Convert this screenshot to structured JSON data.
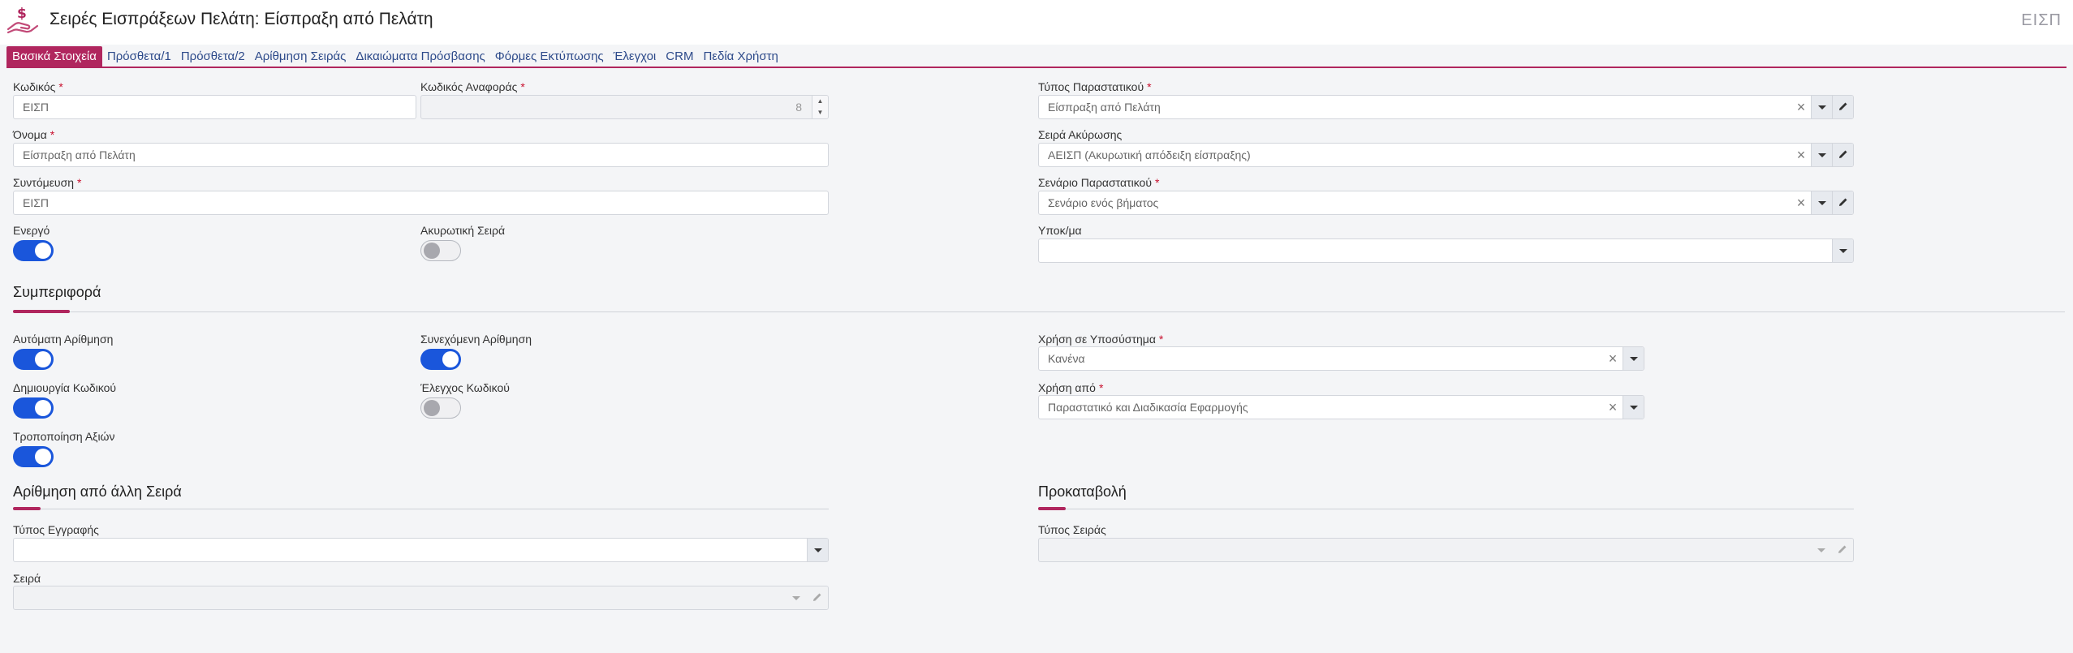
{
  "header": {
    "title": "Σειρές Εισπράξεων Πελάτη: Είσπραξη από Πελάτη",
    "code": "ΕΙΣΠ",
    "icon": "hand-money-icon"
  },
  "tabs": [
    {
      "label": "Βασικά Στοιχεία",
      "active": true
    },
    {
      "label": "Πρόσθετα/1"
    },
    {
      "label": "Πρόσθετα/2"
    },
    {
      "label": "Αρίθμηση Σειράς"
    },
    {
      "label": "Δικαιώματα Πρόσβασης"
    },
    {
      "label": "Φόρμες Εκτύπωσης"
    },
    {
      "label": "Έλεγχοι"
    },
    {
      "label": "CRM"
    },
    {
      "label": "Πεδία Χρήστη"
    }
  ],
  "basic": {
    "code": {
      "label": "Κωδικός",
      "value": "ΕΙΣΠ"
    },
    "ref_code": {
      "label": "Κωδικός Αναφοράς",
      "value": "8"
    },
    "name": {
      "label": "Όνομα",
      "value": "Είσπραξη από Πελάτη"
    },
    "short": {
      "label": "Συντόμευση",
      "value": "ΕΙΣΠ"
    },
    "active": {
      "label": "Ενεργό",
      "on": true
    },
    "cancel_series": {
      "label": "Ακυρωτική Σειρά",
      "on": false
    },
    "doc_type": {
      "label": "Τύπος Παραστατικού",
      "value": "Είσπραξη από Πελάτη"
    },
    "cancel_ser": {
      "label": "Σειρά Ακύρωσης",
      "value": "ΑΕΙΣΠ (Ακυρωτική απόδειξη είσπραξης)"
    },
    "scenario": {
      "label": "Σενάριο Παραστατικού",
      "value": "Σενάριο ενός βήματος"
    },
    "branch": {
      "label": "Υποκ/μα",
      "value": ""
    }
  },
  "behavior": {
    "title": "Συμπεριφορά",
    "auto_num": {
      "label": "Αυτόματη Αρίθμηση",
      "on": true
    },
    "continuous": {
      "label": "Συνεχόμενη Αρίθμηση",
      "on": true
    },
    "gen_code": {
      "label": "Δημιουργία Κωδικού",
      "on": true
    },
    "check_code": {
      "label": "Έλεγχος Κωδικού",
      "on": false
    },
    "modify_values": {
      "label": "Τροποποίηση Αξιών",
      "on": true
    },
    "subsystem": {
      "label": "Χρήση σε Υποσύστημα",
      "value": "Κανένα"
    },
    "used_by": {
      "label": "Χρήση από",
      "value": "Παραστατικό και Διαδικασία Εφαρμογής"
    }
  },
  "numbering_other": {
    "title": "Αρίθμηση από άλλη Σειρά",
    "record_type": {
      "label": "Τύπος Εγγραφής",
      "value": ""
    },
    "series": {
      "label": "Σειρά",
      "value": ""
    }
  },
  "advance": {
    "title": "Προκαταβολή",
    "series_type": {
      "label": "Τύπος Σειράς",
      "value": ""
    }
  },
  "colors": {
    "accent": "#b0265e",
    "toggle_on": "#1a56db",
    "link": "#2d4a8a"
  }
}
